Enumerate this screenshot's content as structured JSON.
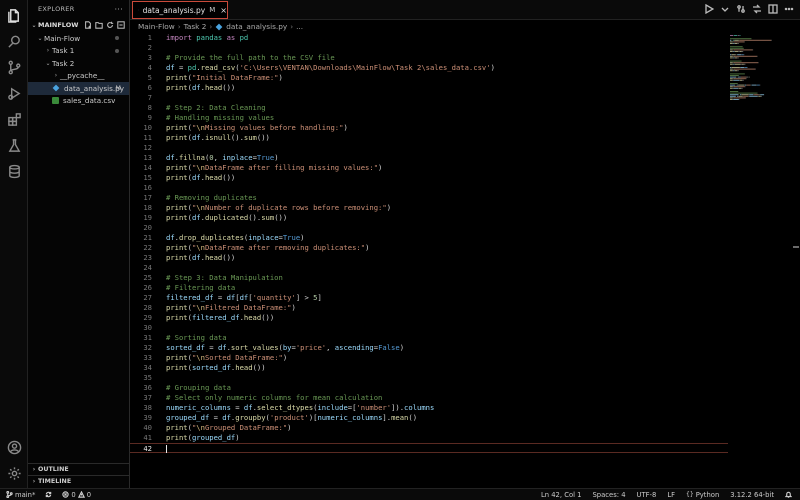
{
  "sidebar": {
    "title": "EXPLORER",
    "more": "···",
    "root": "MAINFLOW",
    "tree": [
      {
        "label": "Main-Flow",
        "chev": "⌄",
        "indent": 8
      },
      {
        "label": "Task 1",
        "chev": "›",
        "indent": 16
      },
      {
        "label": "Task 2",
        "chev": "⌄",
        "indent": 16
      },
      {
        "label": "__pycache__",
        "chev": "›",
        "indent": 24
      },
      {
        "label": "data_analysis.py",
        "mod": "M",
        "indent": 24
      },
      {
        "label": "sales_data.csv",
        "indent": 24
      }
    ],
    "outline": "OUTLINE",
    "timeline": "TIMELINE"
  },
  "tab": {
    "label": "data_analysis.py",
    "mod": "M",
    "close": "×"
  },
  "breadcrumb": [
    "Main-Flow",
    "Task 2",
    "data_analysis.py",
    "..."
  ],
  "editor": {
    "current_line": 42,
    "lines": [
      [
        [
          "kw",
          "import"
        ],
        [
          "pu",
          " "
        ],
        [
          "cl",
          "pandas"
        ],
        [
          "pu",
          " "
        ],
        [
          "kw",
          "as"
        ],
        [
          "pu",
          " "
        ],
        [
          "cl",
          "pd"
        ]
      ],
      [],
      [
        [
          "cm",
          "# Provide the full path to the CSV file"
        ]
      ],
      [
        [
          "id",
          "df"
        ],
        [
          "pu",
          " = "
        ],
        [
          "cl",
          "pd"
        ],
        [
          "pu",
          "."
        ],
        [
          "fn",
          "read_csv"
        ],
        [
          "pu",
          "("
        ],
        [
          "st",
          "'C:\\Users\\VENTAN\\Downloads\\MainFlow\\Task 2\\sales_data.csv'"
        ],
        [
          "pu",
          ")"
        ]
      ],
      [
        [
          "fn",
          "print"
        ],
        [
          "pu",
          "("
        ],
        [
          "st",
          "\"Initial DataFrame:\""
        ],
        [
          "pu",
          ")"
        ]
      ],
      [
        [
          "fn",
          "print"
        ],
        [
          "pu",
          "("
        ],
        [
          "id",
          "df"
        ],
        [
          "pu",
          "."
        ],
        [
          "fn",
          "head"
        ],
        [
          "pu",
          "())"
        ]
      ],
      [],
      [
        [
          "cm",
          "# Step 2: Data Cleaning"
        ]
      ],
      [
        [
          "cm",
          "# Handling missing values"
        ]
      ],
      [
        [
          "fn",
          "print"
        ],
        [
          "pu",
          "("
        ],
        [
          "st",
          "\""
        ],
        [
          "es",
          "\\n"
        ],
        [
          "st",
          "Missing values before handling:\""
        ],
        [
          "pu",
          ")"
        ]
      ],
      [
        [
          "fn",
          "print"
        ],
        [
          "pu",
          "("
        ],
        [
          "id",
          "df"
        ],
        [
          "pu",
          "."
        ],
        [
          "fn",
          "isnull"
        ],
        [
          "pu",
          "()."
        ],
        [
          "fn",
          "sum"
        ],
        [
          "pu",
          "())"
        ]
      ],
      [],
      [
        [
          "id",
          "df"
        ],
        [
          "pu",
          "."
        ],
        [
          "fn",
          "fillna"
        ],
        [
          "pu",
          "("
        ],
        [
          "nm",
          "0"
        ],
        [
          "pu",
          ", "
        ],
        [
          "id",
          "inplace"
        ],
        [
          "pu",
          "="
        ],
        [
          "bl",
          "True"
        ],
        [
          "pu",
          ")"
        ]
      ],
      [
        [
          "fn",
          "print"
        ],
        [
          "pu",
          "("
        ],
        [
          "st",
          "\""
        ],
        [
          "es",
          "\\n"
        ],
        [
          "st",
          "DataFrame after filling missing values:\""
        ],
        [
          "pu",
          ")"
        ]
      ],
      [
        [
          "fn",
          "print"
        ],
        [
          "pu",
          "("
        ],
        [
          "id",
          "df"
        ],
        [
          "pu",
          "."
        ],
        [
          "fn",
          "head"
        ],
        [
          "pu",
          "())"
        ]
      ],
      [],
      [
        [
          "cm",
          "# Removing duplicates"
        ]
      ],
      [
        [
          "fn",
          "print"
        ],
        [
          "pu",
          "("
        ],
        [
          "st",
          "\""
        ],
        [
          "es",
          "\\n"
        ],
        [
          "st",
          "Number of duplicate rows before removing:\""
        ],
        [
          "pu",
          ")"
        ]
      ],
      [
        [
          "fn",
          "print"
        ],
        [
          "pu",
          "("
        ],
        [
          "id",
          "df"
        ],
        [
          "pu",
          "."
        ],
        [
          "fn",
          "duplicated"
        ],
        [
          "pu",
          "()."
        ],
        [
          "fn",
          "sum"
        ],
        [
          "pu",
          "())"
        ]
      ],
      [],
      [
        [
          "id",
          "df"
        ],
        [
          "pu",
          "."
        ],
        [
          "fn",
          "drop_duplicates"
        ],
        [
          "pu",
          "("
        ],
        [
          "id",
          "inplace"
        ],
        [
          "pu",
          "="
        ],
        [
          "bl",
          "True"
        ],
        [
          "pu",
          ")"
        ]
      ],
      [
        [
          "fn",
          "print"
        ],
        [
          "pu",
          "("
        ],
        [
          "st",
          "\""
        ],
        [
          "es",
          "\\n"
        ],
        [
          "st",
          "DataFrame after removing duplicates:\""
        ],
        [
          "pu",
          ")"
        ]
      ],
      [
        [
          "fn",
          "print"
        ],
        [
          "pu",
          "("
        ],
        [
          "id",
          "df"
        ],
        [
          "pu",
          "."
        ],
        [
          "fn",
          "head"
        ],
        [
          "pu",
          "())"
        ]
      ],
      [],
      [
        [
          "cm",
          "# Step 3: Data Manipulation"
        ]
      ],
      [
        [
          "cm",
          "# Filtering data"
        ]
      ],
      [
        [
          "id",
          "filtered_df"
        ],
        [
          "pu",
          " = "
        ],
        [
          "id",
          "df"
        ],
        [
          "pu",
          "["
        ],
        [
          "id",
          "df"
        ],
        [
          "pu",
          "["
        ],
        [
          "st",
          "'quantity'"
        ],
        [
          "pu",
          "] > "
        ],
        [
          "nm",
          "5"
        ],
        [
          "pu",
          "]"
        ]
      ],
      [
        [
          "fn",
          "print"
        ],
        [
          "pu",
          "("
        ],
        [
          "st",
          "\""
        ],
        [
          "es",
          "\\n"
        ],
        [
          "st",
          "Filtered DataFrame:\""
        ],
        [
          "pu",
          ")"
        ]
      ],
      [
        [
          "fn",
          "print"
        ],
        [
          "pu",
          "("
        ],
        [
          "id",
          "filtered_df"
        ],
        [
          "pu",
          "."
        ],
        [
          "fn",
          "head"
        ],
        [
          "pu",
          "())"
        ]
      ],
      [],
      [
        [
          "cm",
          "# Sorting data"
        ]
      ],
      [
        [
          "id",
          "sorted_df"
        ],
        [
          "pu",
          " = "
        ],
        [
          "id",
          "df"
        ],
        [
          "pu",
          "."
        ],
        [
          "fn",
          "sort_values"
        ],
        [
          "pu",
          "("
        ],
        [
          "id",
          "by"
        ],
        [
          "pu",
          "="
        ],
        [
          "st",
          "'price'"
        ],
        [
          "pu",
          ", "
        ],
        [
          "id",
          "ascending"
        ],
        [
          "pu",
          "="
        ],
        [
          "bl",
          "False"
        ],
        [
          "pu",
          ")"
        ]
      ],
      [
        [
          "fn",
          "print"
        ],
        [
          "pu",
          "("
        ],
        [
          "st",
          "\""
        ],
        [
          "es",
          "\\n"
        ],
        [
          "st",
          "Sorted DataFrame:\""
        ],
        [
          "pu",
          ")"
        ]
      ],
      [
        [
          "fn",
          "print"
        ],
        [
          "pu",
          "("
        ],
        [
          "id",
          "sorted_df"
        ],
        [
          "pu",
          "."
        ],
        [
          "fn",
          "head"
        ],
        [
          "pu",
          "())"
        ]
      ],
      [],
      [
        [
          "cm",
          "# Grouping data"
        ]
      ],
      [
        [
          "cm",
          "# Select only numeric columns for mean calculation"
        ]
      ],
      [
        [
          "id",
          "numeric_columns"
        ],
        [
          "pu",
          " = "
        ],
        [
          "id",
          "df"
        ],
        [
          "pu",
          "."
        ],
        [
          "fn",
          "select_dtypes"
        ],
        [
          "pu",
          "("
        ],
        [
          "id",
          "include"
        ],
        [
          "pu",
          "=["
        ],
        [
          "st",
          "'number'"
        ],
        [
          "pu",
          "])."
        ],
        [
          "id",
          "columns"
        ]
      ],
      [
        [
          "id",
          "grouped_df"
        ],
        [
          "pu",
          " = "
        ],
        [
          "id",
          "df"
        ],
        [
          "pu",
          "."
        ],
        [
          "fn",
          "groupby"
        ],
        [
          "pu",
          "("
        ],
        [
          "st",
          "'product'"
        ],
        [
          "pu",
          ")["
        ],
        [
          "id",
          "numeric_columns"
        ],
        [
          "pu",
          "]."
        ],
        [
          "fn",
          "mean"
        ],
        [
          "pu",
          "()"
        ]
      ],
      [
        [
          "fn",
          "print"
        ],
        [
          "pu",
          "("
        ],
        [
          "st",
          "\""
        ],
        [
          "es",
          "\\n"
        ],
        [
          "st",
          "Grouped DataFrame:\""
        ],
        [
          "pu",
          ")"
        ]
      ],
      [
        [
          "fn",
          "print"
        ],
        [
          "pu",
          "("
        ],
        [
          "id",
          "grouped_df"
        ],
        [
          "pu",
          ")"
        ]
      ],
      []
    ]
  },
  "status": {
    "branch": "main*",
    "errors": "0",
    "warnings": "0",
    "position": "Ln 42, Col 1",
    "spaces": "Spaces: 4",
    "encoding": "UTF-8",
    "eol": "LF",
    "language": "Python",
    "interpreter": "3.12.2 64-bit"
  },
  "colors": {
    "accent_border": "#c94a3a",
    "python_icon": "#4aa3df",
    "csv_icon": "#3a8a3a"
  }
}
